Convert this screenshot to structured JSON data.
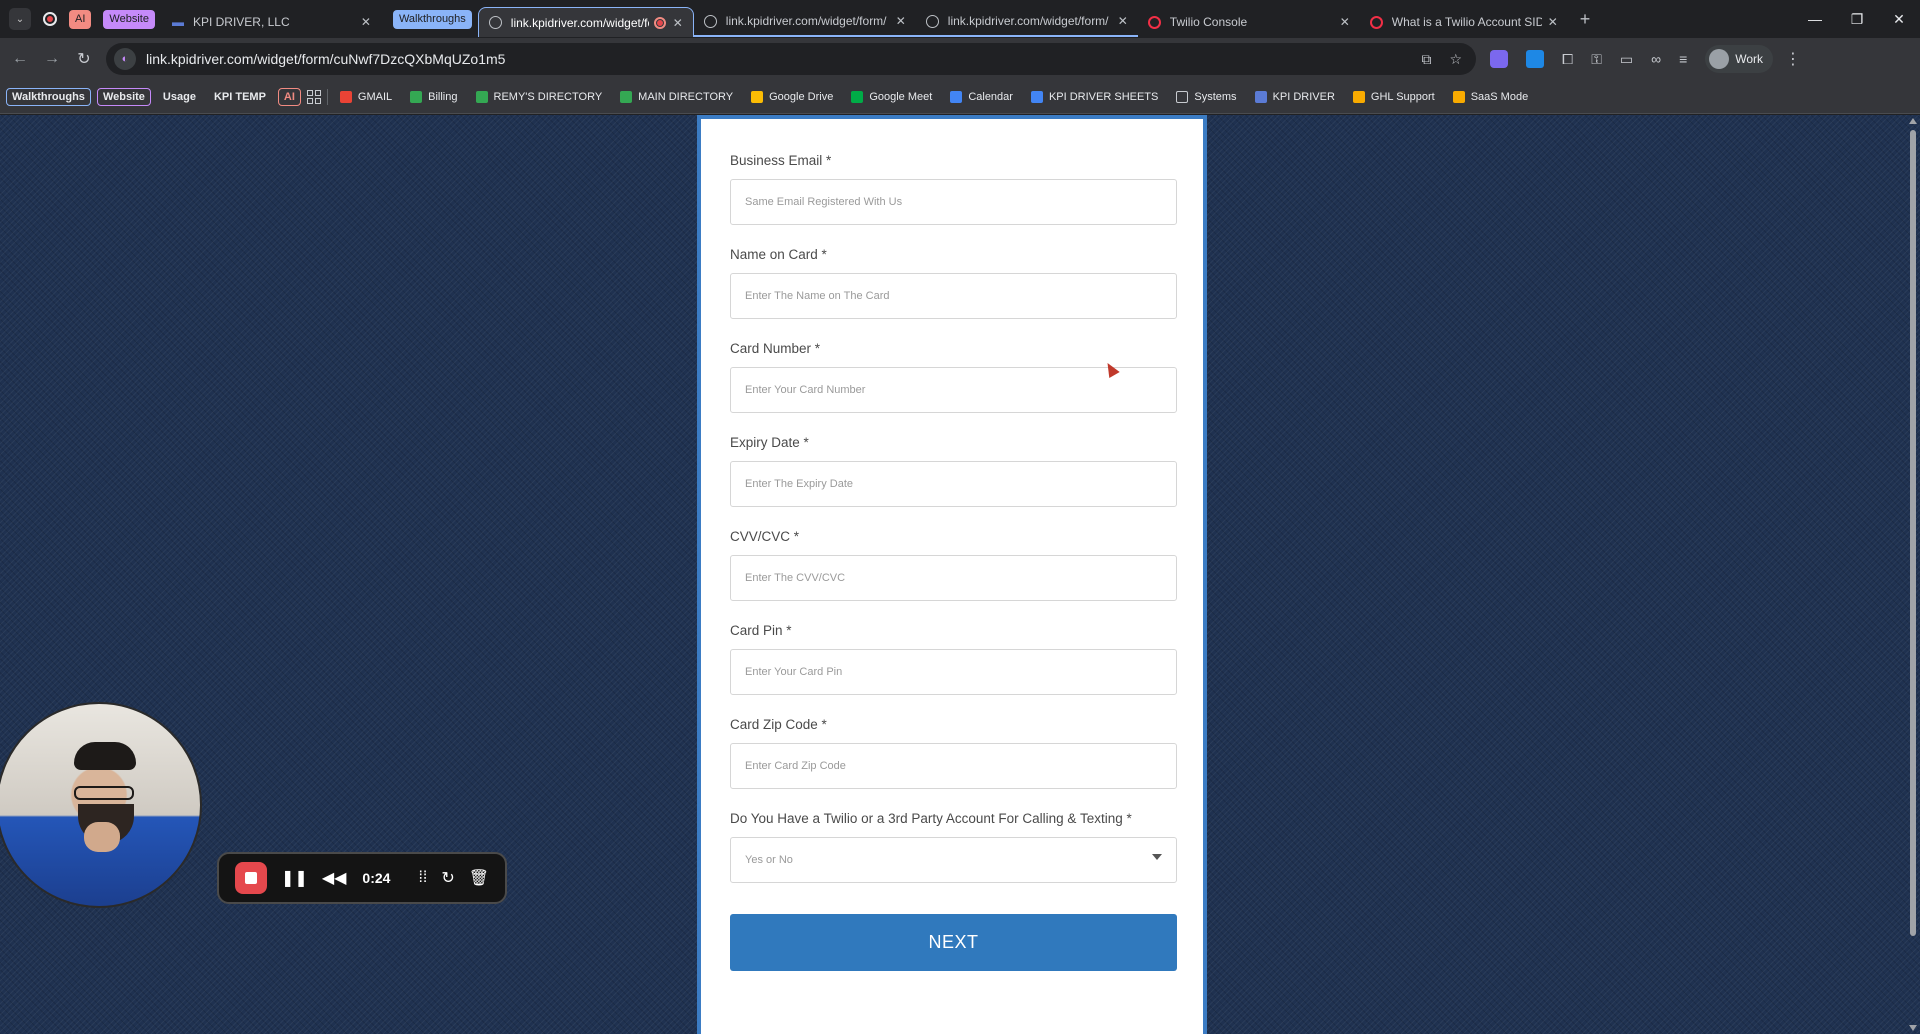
{
  "browser": {
    "tab_groups": {
      "ai": "AI",
      "website": "Website",
      "walkthroughs": "Walkthroughs"
    },
    "tabs": [
      {
        "title": "KPI DRIVER, LLC",
        "icon": "kpi-logo-icon"
      },
      {
        "title": "link.kpidriver.com/widget/fo",
        "icon": "globe-icon",
        "active": true
      },
      {
        "title": "link.kpidriver.com/widget/form/",
        "icon": "globe-icon"
      },
      {
        "title": "link.kpidriver.com/widget/form/",
        "icon": "globe-icon"
      },
      {
        "title": "Twilio Console",
        "icon": "twilio-icon"
      },
      {
        "title": "What is a Twilio Account SID an",
        "icon": "twilio-icon"
      }
    ],
    "url": "link.kpidriver.com/widget/form/cuNwf7DzcQXbMqUZo1m5",
    "profile_label": "Work",
    "bookmarks": {
      "walkthroughs": "Walkthroughs",
      "website": "Website",
      "usage": "Usage",
      "kpi_temp": "KPI TEMP",
      "ai": "AI",
      "items": [
        {
          "label": "GMAIL",
          "color": "#ea4335"
        },
        {
          "label": "Billing",
          "color": "#34a853"
        },
        {
          "label": "REMY'S DIRECTORY",
          "color": "#34a853"
        },
        {
          "label": "MAIN DIRECTORY",
          "color": "#34a853"
        },
        {
          "label": "Google Drive",
          "color": "#fbbc04"
        },
        {
          "label": "Google Meet",
          "color": "#00ac47"
        },
        {
          "label": "Calendar",
          "color": "#4285f4"
        },
        {
          "label": "KPI DRIVER SHEETS",
          "color": "#4285f4"
        },
        {
          "label": "Systems",
          "color": "#9aa0a6"
        },
        {
          "label": "KPI DRIVER",
          "color": "#5b7bd5"
        },
        {
          "label": "GHL Support",
          "color": "#f9ab00"
        },
        {
          "label": "SaaS Mode",
          "color": "#f9ab00"
        }
      ]
    }
  },
  "form": {
    "fields": [
      {
        "label": "Business Email *",
        "placeholder": "Same Email Registered With Us"
      },
      {
        "label": "Name on Card *",
        "placeholder": "Enter The Name on The Card"
      },
      {
        "label": "Card Number *",
        "placeholder": "Enter Your Card Number"
      },
      {
        "label": "Expiry Date *",
        "placeholder": "Enter The Expiry Date"
      },
      {
        "label": "CVV/CVC *",
        "placeholder": "Enter The CVV/CVC"
      },
      {
        "label": "Card Pin *",
        "placeholder": "Enter Your Card Pin"
      },
      {
        "label": "Card Zip Code *",
        "placeholder": "Enter Card Zip Code"
      }
    ],
    "twilio_question": {
      "label": "Do You Have a Twilio or a 3rd Party Account For Calling & Texting *",
      "selected": "Yes or No"
    },
    "next_button": "NEXT"
  },
  "recorder": {
    "elapsed": "0:24"
  }
}
